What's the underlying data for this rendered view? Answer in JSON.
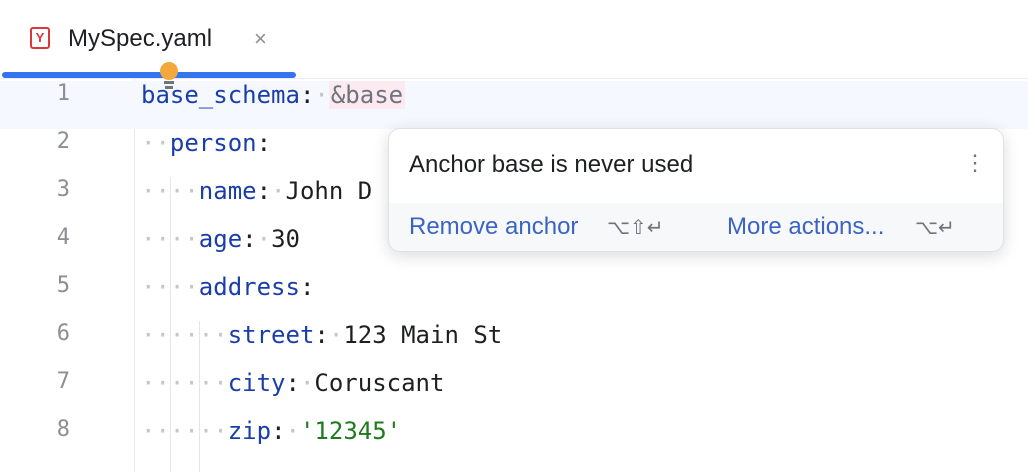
{
  "tab": {
    "icon_letter": "Y",
    "title": "MySpec.yaml",
    "close_glyph": "×",
    "icon": "yaml-file-icon"
  },
  "editor": {
    "lines": [
      {
        "n": "1"
      },
      {
        "n": "2"
      },
      {
        "n": "3"
      },
      {
        "n": "4"
      },
      {
        "n": "5"
      },
      {
        "n": "6"
      },
      {
        "n": "7"
      },
      {
        "n": "8"
      }
    ],
    "tokens": {
      "base_schema": "base_schema",
      "anchor": "&base",
      "person": "person",
      "name_key": "name",
      "name_val": "John D",
      "age_key": "age",
      "age_val": "30",
      "address_key": "address",
      "street_key": "street",
      "street_val": "123 Main St",
      "city_key": "city",
      "city_val": "Coruscant",
      "zip_key": "zip",
      "zip_val": "'12345'"
    },
    "current_line": "1"
  },
  "intention_bulb": {
    "icon": "lightbulb-icon",
    "color": "#f2a83c"
  },
  "popup": {
    "message": "Anchor base is never used",
    "menu_glyph": "⋮",
    "actions": [
      {
        "label": "Remove anchor",
        "shortcut": "⌥⇧↵"
      },
      {
        "label": "More actions...",
        "shortcut": "⌥↵"
      }
    ]
  },
  "colors": {
    "accent": "#3574f0",
    "key": "#1a3ea8",
    "string": "#1d7b1d",
    "link": "#3a63c4"
  }
}
